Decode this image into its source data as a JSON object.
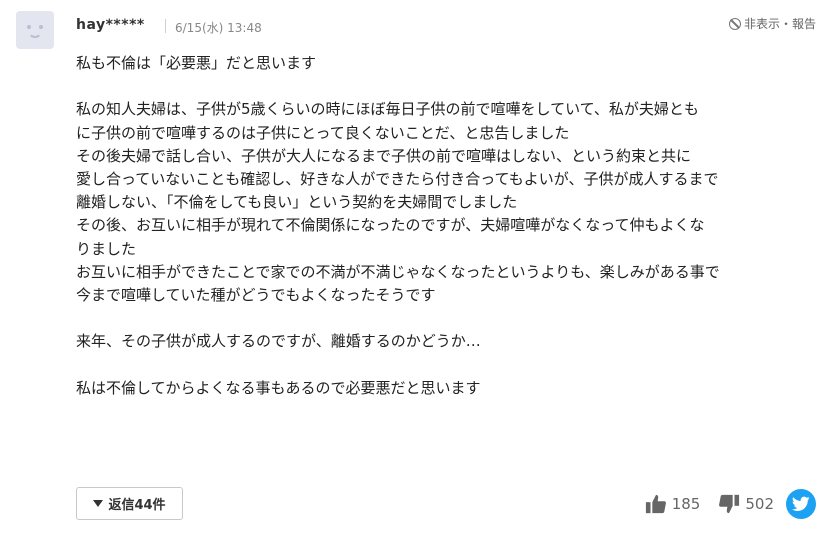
{
  "comment": {
    "username": "hay*****",
    "date": "6/15(水) 13:48",
    "hide_report": "非表示・報告",
    "lines": [
      "私も不倫は「必要悪」だと思います",
      "",
      "私の知人夫婦は、子供が5歳くらいの時にほぼ毎日子供の前で喧嘩をしていて、私が夫婦とも",
      "に子供の前で喧嘩するのは子供にとって良くないことだ、と忠告しました",
      "その後夫婦で話し合い、子供が大人になるまで子供の前で喧嘩はしない、という約束と共に",
      "愛し合っていないことも確認し、好きな人ができたら付き合ってもよいが、子供が成人するまで",
      "離婚しない、「不倫をしても良い」という契約を夫婦間でしました",
      "その後、お互いに相手が現れて不倫関係になったのですが、夫婦喧嘩がなくなって仲もよくな",
      "りました",
      "お互いに相手ができたことで家での不満が不満じゃなくなったというよりも、楽しみがある事で",
      "今まで喧嘩していた種がどうでもよくなったそうです",
      "",
      "来年、その子供が成人するのですが、離婚するのかどうか…",
      "",
      "私は不倫してからよくなる事もあるので必要悪だと思います"
    ],
    "reply_label": "返信44件",
    "likes": "185",
    "dislikes": "502"
  },
  "icons": {
    "avatar": "avatar-smiley-icon",
    "hide": "ban-icon",
    "reply": "triangle-down-icon",
    "like": "thumbs-up-icon",
    "dislike": "thumbs-down-icon",
    "share": "twitter-icon"
  },
  "colors": {
    "twitter": "#1da1f2",
    "avatar_bg": "#e3e6ee",
    "text": "#222222",
    "muted": "#888888"
  }
}
